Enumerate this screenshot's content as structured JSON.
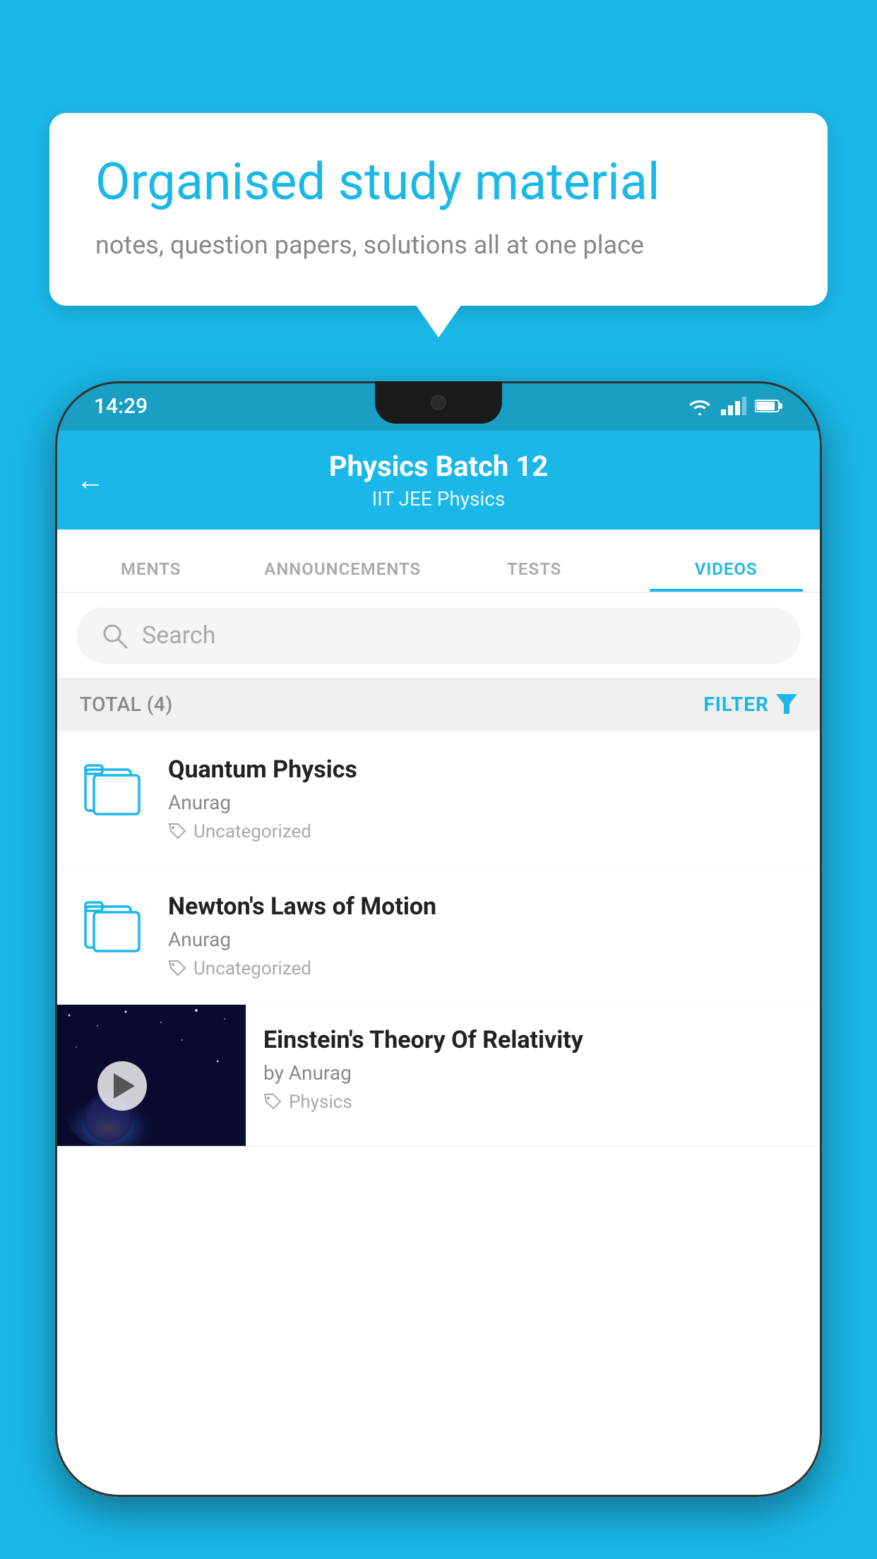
{
  "background_color": "#1ab8e8",
  "bubble": {
    "title": "Organised study material",
    "subtitle": "notes, question papers, solutions all at one place"
  },
  "status_bar": {
    "time": "14:29",
    "wifi": "▼▲",
    "battery": "▮"
  },
  "app_bar": {
    "title": "Physics Batch 12",
    "subtitle": "IIT JEE   Physics",
    "back_label": "←"
  },
  "tabs": [
    {
      "label": "MENTS",
      "active": false
    },
    {
      "label": "ANNOUNCEMENTS",
      "active": false
    },
    {
      "label": "TESTS",
      "active": false
    },
    {
      "label": "VIDEOS",
      "active": true
    }
  ],
  "search": {
    "placeholder": "Search"
  },
  "filter_row": {
    "total_label": "TOTAL (4)",
    "filter_label": "FILTER"
  },
  "videos": [
    {
      "title": "Quantum Physics",
      "author": "Anurag",
      "tag": "Uncategorized",
      "has_thumb": false
    },
    {
      "title": "Newton's Laws of Motion",
      "author": "Anurag",
      "tag": "Uncategorized",
      "has_thumb": false
    },
    {
      "title": "Einstein's Theory Of Relativity",
      "author": "by Anurag",
      "tag": "Physics",
      "has_thumb": true
    }
  ]
}
